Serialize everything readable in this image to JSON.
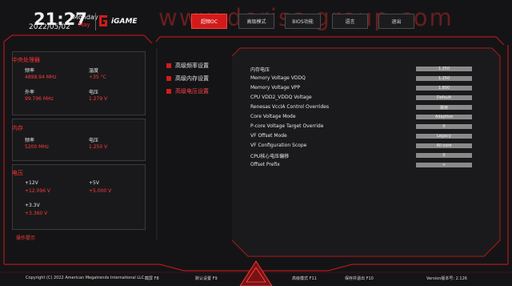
{
  "header": {
    "time": "21:27",
    "date": "2022/05/02",
    "day": "Monday",
    "month": "May",
    "brand": "iGAME",
    "watermark": "www.deriss.group.com"
  },
  "tabs": [
    {
      "label": "超频OC",
      "active": true
    },
    {
      "label": "高级模式",
      "active": false
    },
    {
      "label": "BIOS功能",
      "active": false
    },
    {
      "label": "语言",
      "active": false
    },
    {
      "label": "退出",
      "active": false
    }
  ],
  "cpu_panel": {
    "title": "中央处理器",
    "freq_label": "频率",
    "freq_value": "4898.94 MHz",
    "temp_label": "温度",
    "temp_value": "+35 °C",
    "bclk_label": "外率",
    "bclk_value": "99.796 MHz",
    "volt_label": "电压",
    "volt_value": "1.279 V"
  },
  "mem_panel": {
    "title": "内存",
    "freq_label": "频率",
    "freq_value": "5200 MHz",
    "volt_label": "电压",
    "volt_value": "1.250 V"
  },
  "volt_panel": {
    "title": "电压",
    "v12_label": "+12V",
    "v12_value": "+12.096 V",
    "v5_label": "+5V",
    "v5_value": "+5.000 V",
    "v33_label": "+3.3V",
    "v33_value": "+3.360 V"
  },
  "sidebar_hint": "操作提示",
  "menu": [
    {
      "label": "高级频率设置",
      "active": false
    },
    {
      "label": "高级内存设置",
      "active": false
    },
    {
      "label": "高级电压设置",
      "active": true
    }
  ],
  "settings": [
    {
      "label": "内存电压",
      "value": "1.250"
    },
    {
      "label": "Memory Voltage VDDQ",
      "value": "1.250"
    },
    {
      "label": "Memory Voltage VPP",
      "value": "1.800"
    },
    {
      "label": "CPU VDD2_VDDQ Voltage",
      "value": "Default"
    },
    {
      "label": "Renesas VccIA Control Overrides",
      "value": "禁用"
    },
    {
      "label": "Core Voltage Mode",
      "value": "Adaptive"
    },
    {
      "label": "P-core Voltage Target Override",
      "value": "0"
    },
    {
      "label": "VF Offset Mode",
      "value": "Legacy"
    },
    {
      "label": "VF Configuration Scope",
      "value": "All-core"
    },
    {
      "label": "CPU核心电压偏移",
      "value": "0"
    },
    {
      "label": "Offset Prefix",
      "value": "+"
    }
  ],
  "footer": {
    "copyright": "Copyright (C) 2022 American Megatrends International LLC",
    "k1": "截屏 F8",
    "k2": "默认设置 F9",
    "k3": "高级模式 F11",
    "k4": "保存并退出 F10",
    "version": "Version版本号: 2.126"
  },
  "colors": {
    "accent": "#d31a1a",
    "bg": "#141416"
  }
}
